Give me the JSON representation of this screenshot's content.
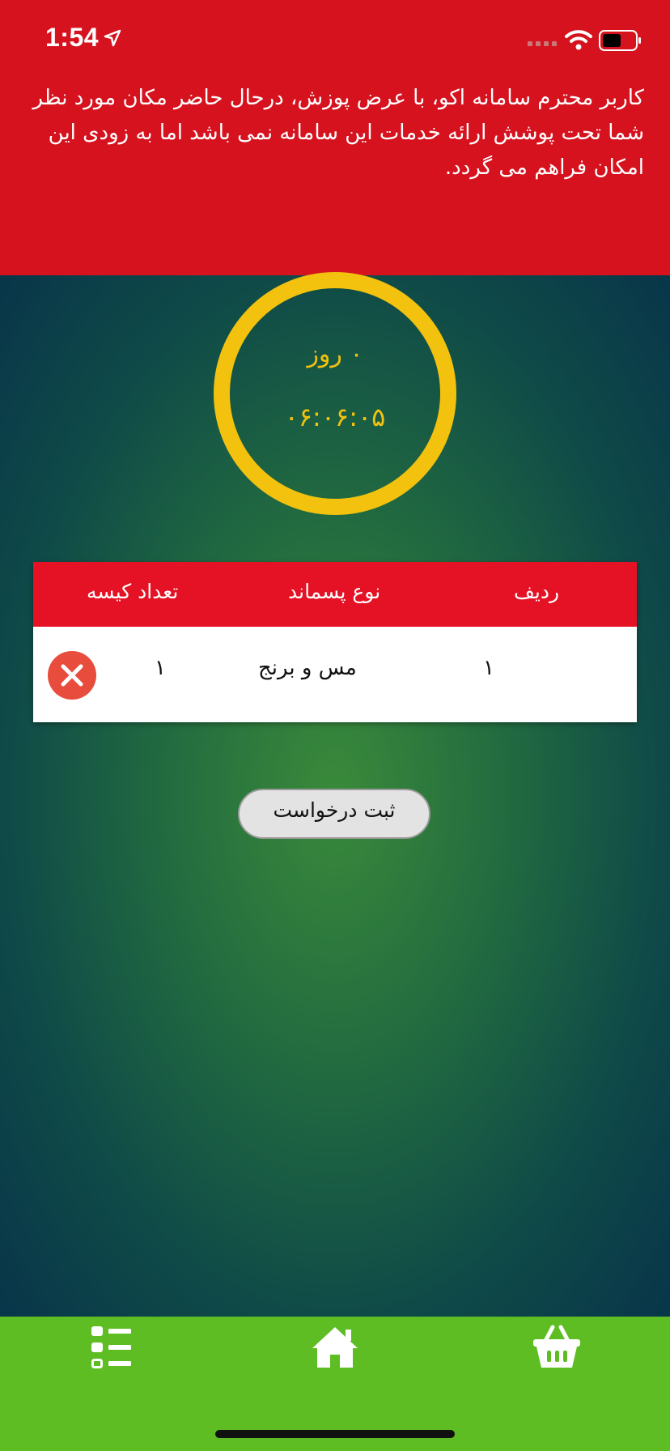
{
  "status_bar": {
    "time": "1:54"
  },
  "alert": {
    "message": "کاربر محترم سامانه اکو، با عرض پوزش، درحال حاضر مکان مورد نظر  شما تحت پوشش ارائه خدمات این سامانه نمی باشد اما به زودی این امکان فراهم می گردد."
  },
  "timer": {
    "days": "۰ روز",
    "clock": "۰۶:۰۶:۰۵"
  },
  "table": {
    "headers": {
      "row": "ردیف",
      "waste_type": "نوع پسماند",
      "bag_count": "تعداد کیسه"
    },
    "rows": [
      {
        "row": "۱",
        "waste_type": "مس و برنج",
        "bag_count": "۱"
      }
    ]
  },
  "submit_label": "ثبت درخواست",
  "tabs": [
    "list-icon",
    "home-icon",
    "basket-icon"
  ],
  "colors": {
    "alert_bg": "#d5121e",
    "timer": "#f2c20f",
    "table_header": "#e51124",
    "tabbar": "#5dbd23",
    "remove": "#e74c3c"
  }
}
